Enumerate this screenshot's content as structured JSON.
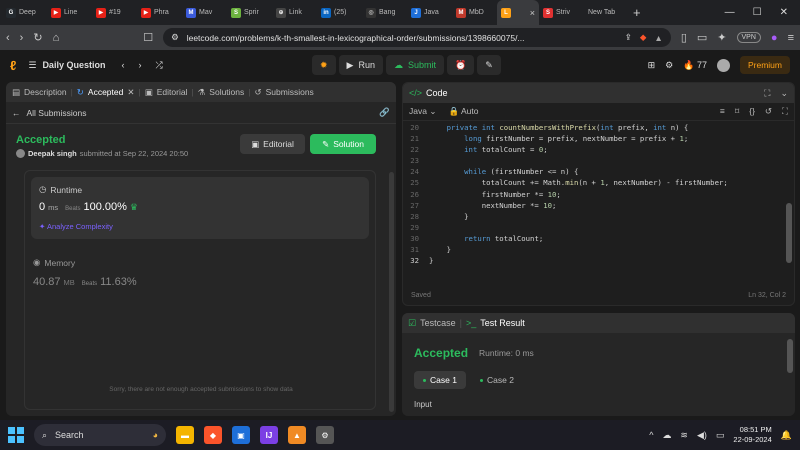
{
  "browser": {
    "tabs": [
      {
        "label": "Deep",
        "color": "#24292e",
        "glyph": "G"
      },
      {
        "label": "Line",
        "color": "#e62117",
        "glyph": "▶"
      },
      {
        "label": "#19",
        "color": "#e62117",
        "glyph": "▶"
      },
      {
        "label": "Phra",
        "color": "#e62117",
        "glyph": "▶"
      },
      {
        "label": "Mav",
        "color": "#3b5bdb",
        "glyph": "M"
      },
      {
        "label": "Sprir",
        "color": "#6db33f",
        "glyph": "S"
      },
      {
        "label": "Link",
        "color": "#444",
        "glyph": "⊕"
      },
      {
        "label": "(25)",
        "color": "#0a66c2",
        "glyph": "in"
      },
      {
        "label": "Bang",
        "color": "#333",
        "glyph": "◎"
      },
      {
        "label": "Java",
        "color": "#1e6fd9",
        "glyph": "J"
      },
      {
        "label": "MbD",
        "color": "#c0392b",
        "glyph": "M"
      }
    ],
    "active_tab": {
      "label": "",
      "color": "#ffa116",
      "glyph": "L"
    },
    "more_tabs": [
      {
        "label": "Striv",
        "color": "#e03131",
        "glyph": "S"
      },
      {
        "label": "New Tab",
        "color": "",
        "glyph": ""
      }
    ],
    "url": "leetcode.com/problems/k-th-smallest-in-lexicographical-order/submissions/1398660075/...",
    "vpn_label": "VPN"
  },
  "lc": {
    "daily_question": "Daily Question",
    "run_label": "Run",
    "submit_label": "Submit",
    "streak": "77",
    "premium_label": "Premium"
  },
  "left": {
    "tabs": [
      "Description",
      "Accepted",
      "Editorial",
      "Solutions",
      "Submissions"
    ],
    "all_submissions": "All Submissions",
    "status": "Accepted",
    "author": "Deepak singh",
    "submitted_at": "submitted at Sep 22, 2024 20:50",
    "editorial_btn": "Editorial",
    "solution_btn": "Solution",
    "runtime_label": "Runtime",
    "runtime_value": "0",
    "runtime_unit": "ms",
    "beats_label": "Beats",
    "runtime_beats": "100.00%",
    "analyze_label": "Analyze Complexity",
    "memory_label": "Memory",
    "memory_value": "40.87",
    "memory_unit": "MB",
    "memory_beats": "11.63%",
    "sorry_text": "Sorry, there are not enough accepted submissions to show data"
  },
  "code": {
    "title": "Code",
    "language": "Java",
    "auto_label": "Auto",
    "saved_label": "Saved",
    "cursor_pos": "Ln 32, Col 2",
    "lines": [
      {
        "n": "20",
        "t": "    private int countNumbersWithPrefix(int prefix, int n) {"
      },
      {
        "n": "21",
        "t": "        long firstNumber = prefix, nextNumber = prefix + 1;"
      },
      {
        "n": "22",
        "t": "        int totalCount = 0;"
      },
      {
        "n": "23",
        "t": ""
      },
      {
        "n": "24",
        "t": "        while (firstNumber <= n) {"
      },
      {
        "n": "25",
        "t": "            totalCount += Math.min(n + 1, nextNumber) - firstNumber;"
      },
      {
        "n": "26",
        "t": "            firstNumber *= 10;"
      },
      {
        "n": "27",
        "t": "            nextNumber *= 10;"
      },
      {
        "n": "28",
        "t": "        }"
      },
      {
        "n": "29",
        "t": ""
      },
      {
        "n": "30",
        "t": "        return totalCount;"
      },
      {
        "n": "31",
        "t": "    }"
      },
      {
        "n": "32",
        "t": "}"
      }
    ]
  },
  "result": {
    "testcase_tab": "Testcase",
    "result_tab": "Test Result",
    "status": "Accepted",
    "runtime": "Runtime: 0 ms",
    "case1": "Case 1",
    "case2": "Case 2",
    "input_label": "Input"
  },
  "taskbar": {
    "search_placeholder": "Search",
    "time": "08:51 PM",
    "date": "22-09-2024"
  }
}
